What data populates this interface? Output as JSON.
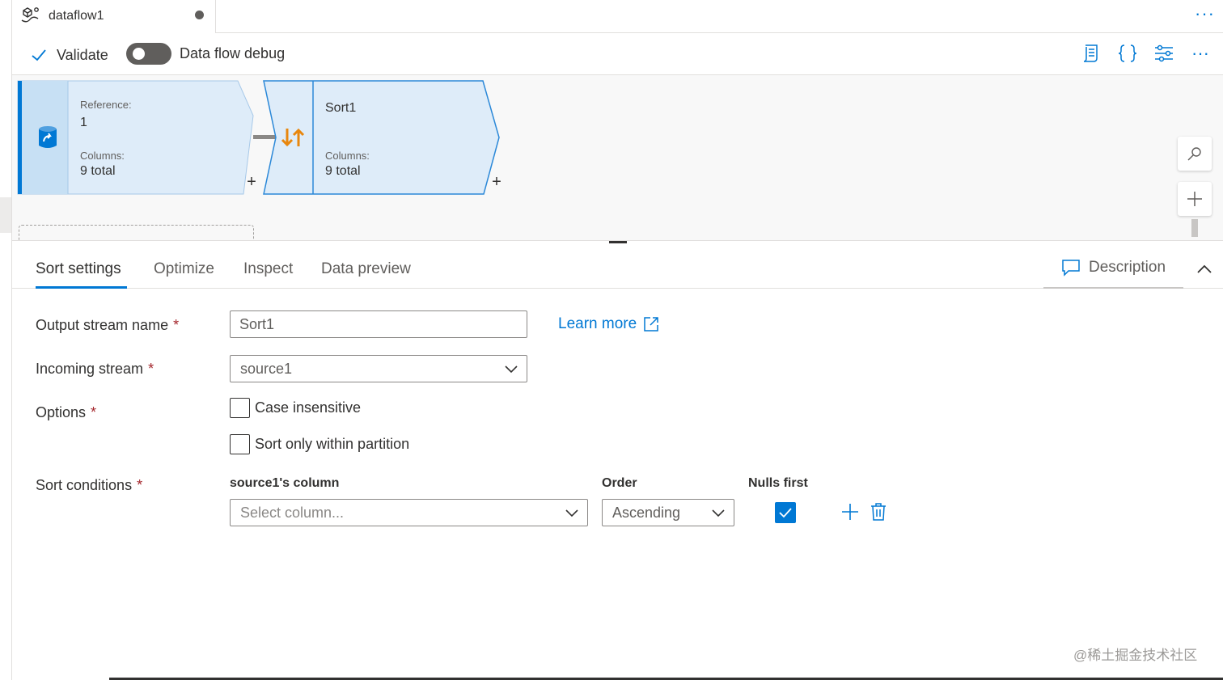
{
  "document_tab": {
    "title": "dataflow1",
    "icon": "dataflow-icon",
    "unsaved": true
  },
  "toolbar": {
    "validate_label": "Validate",
    "debug_label": "Data flow debug",
    "debug_enabled": false,
    "right_icons": [
      "script-icon",
      "code-braces-icon",
      "settings-sliders-icon",
      "more-icon"
    ]
  },
  "canvas": {
    "source_node": {
      "icon": "source-database-icon",
      "reference_label": "Reference:",
      "reference_value": "1",
      "columns_label": "Columns:",
      "columns_value": "9 total"
    },
    "sort_node": {
      "icon": "sort-arrows-icon",
      "title": "Sort1",
      "columns_label": "Columns:",
      "columns_value": "9 total"
    },
    "add_symbol": "+"
  },
  "settings_tabs": {
    "items": [
      "Sort settings",
      "Optimize",
      "Inspect",
      "Data preview"
    ],
    "active": "Sort settings",
    "description_label": "Description"
  },
  "form": {
    "output_stream": {
      "label": "Output stream name",
      "required_mark": "*",
      "value": "Sort1"
    },
    "learn_more": "Learn more",
    "incoming_stream": {
      "label": "Incoming stream",
      "required_mark": "*",
      "value": "source1"
    },
    "options": {
      "label": "Options",
      "required_mark": "*",
      "case_insensitive": {
        "label": "Case insensitive",
        "checked": false
      },
      "sort_within_partition": {
        "label": "Sort only within partition",
        "checked": false
      }
    },
    "sort_conditions": {
      "label": "Sort conditions",
      "required_mark": "*",
      "column_header": "source1's column",
      "order_header": "Order",
      "nulls_header": "Nulls first",
      "column_placeholder": "Select column...",
      "order_value": "Ascending",
      "nulls_first": true
    }
  },
  "watermark": "@稀土掘金技术社区",
  "colors": {
    "accent": "#0078d4",
    "node_fill": "#deecf9",
    "node_border": "#2b88d8",
    "sort_icon": "#e8870e"
  }
}
